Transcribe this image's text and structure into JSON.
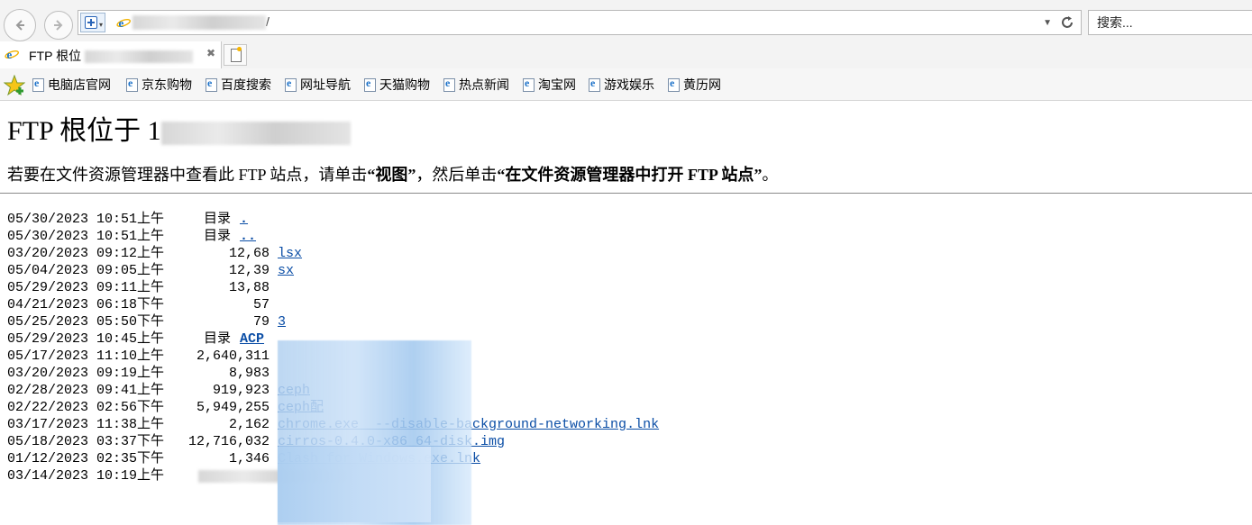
{
  "address_bar": {
    "url_suffix": "/",
    "search_placeholder": "搜索..."
  },
  "tab": {
    "title": "FTP 根位"
  },
  "favorites": [
    {
      "label": "电脑店官网"
    },
    {
      "label": "京东购物"
    },
    {
      "label": "百度搜索"
    },
    {
      "label": "网址导航"
    },
    {
      "label": "天猫购物"
    },
    {
      "label": "热点新闻"
    },
    {
      "label": "淘宝网"
    },
    {
      "label": "游戏娱乐"
    },
    {
      "label": "黄历网"
    }
  ],
  "page": {
    "heading": "FTP 根位于 1",
    "instruction_prefix": "若要在文件资源管理器中查看此 FTP 站点，请单击",
    "instruction_view": "“视图”",
    "instruction_middle": "，然后单击",
    "instruction_open": "“在文件资源管理器中打开 FTP 站点”",
    "instruction_suffix": "。"
  },
  "listing": [
    {
      "date": "05/30/2023 10:51上午",
      "size": "目录",
      "name": ".",
      "dir": true
    },
    {
      "date": "05/30/2023 10:51上午",
      "size": "目录",
      "name": "..",
      "dir": true
    },
    {
      "date": "03/20/2023 09:12上午",
      "size": "12,68",
      "name": "lsx",
      "dir": false
    },
    {
      "date": "05/04/2023 09:05上午",
      "size": "12,39",
      "name": "sx",
      "dir": false
    },
    {
      "date": "05/29/2023 09:11上午",
      "size": "13,88",
      "name": "",
      "dir": false
    },
    {
      "date": "04/21/2023 06:18下午",
      "size": "57",
      "name": "",
      "dir": false
    },
    {
      "date": "05/25/2023 05:50下午",
      "size": "79",
      "name": "3",
      "dir": false
    },
    {
      "date": "05/29/2023 10:45上午",
      "size": "目录",
      "name": "ACP",
      "dir": true
    },
    {
      "date": "05/17/2023 11:10上午",
      "size": "2,640,311",
      "name": "",
      "dir": false
    },
    {
      "date": "03/20/2023 09:19上午",
      "size": "8,983",
      "name": "",
      "dir": false
    },
    {
      "date": "02/28/2023 09:41上午",
      "size": "919,923",
      "name": "ceph",
      "dir": false
    },
    {
      "date": "02/22/2023 02:56下午",
      "size": "5,949,255",
      "name": "ceph配",
      "dir": false
    },
    {
      "date": "03/17/2023 11:38上午",
      "size": "2,162",
      "name": "chrome.exe  --disable-background-networking.lnk",
      "dir": false
    },
    {
      "date": "05/18/2023 03:37下午",
      "size": "12,716,032",
      "name": "cirros-0.4.0-x86_64-disk.img",
      "dir": false
    },
    {
      "date": "01/12/2023 02:35下午",
      "size": "1,346",
      "name": "Clash for Windows.exe.lnk",
      "dir": false
    },
    {
      "date": "03/14/2023 10:19上午",
      "size": "",
      "name": "",
      "dir": false
    }
  ]
}
